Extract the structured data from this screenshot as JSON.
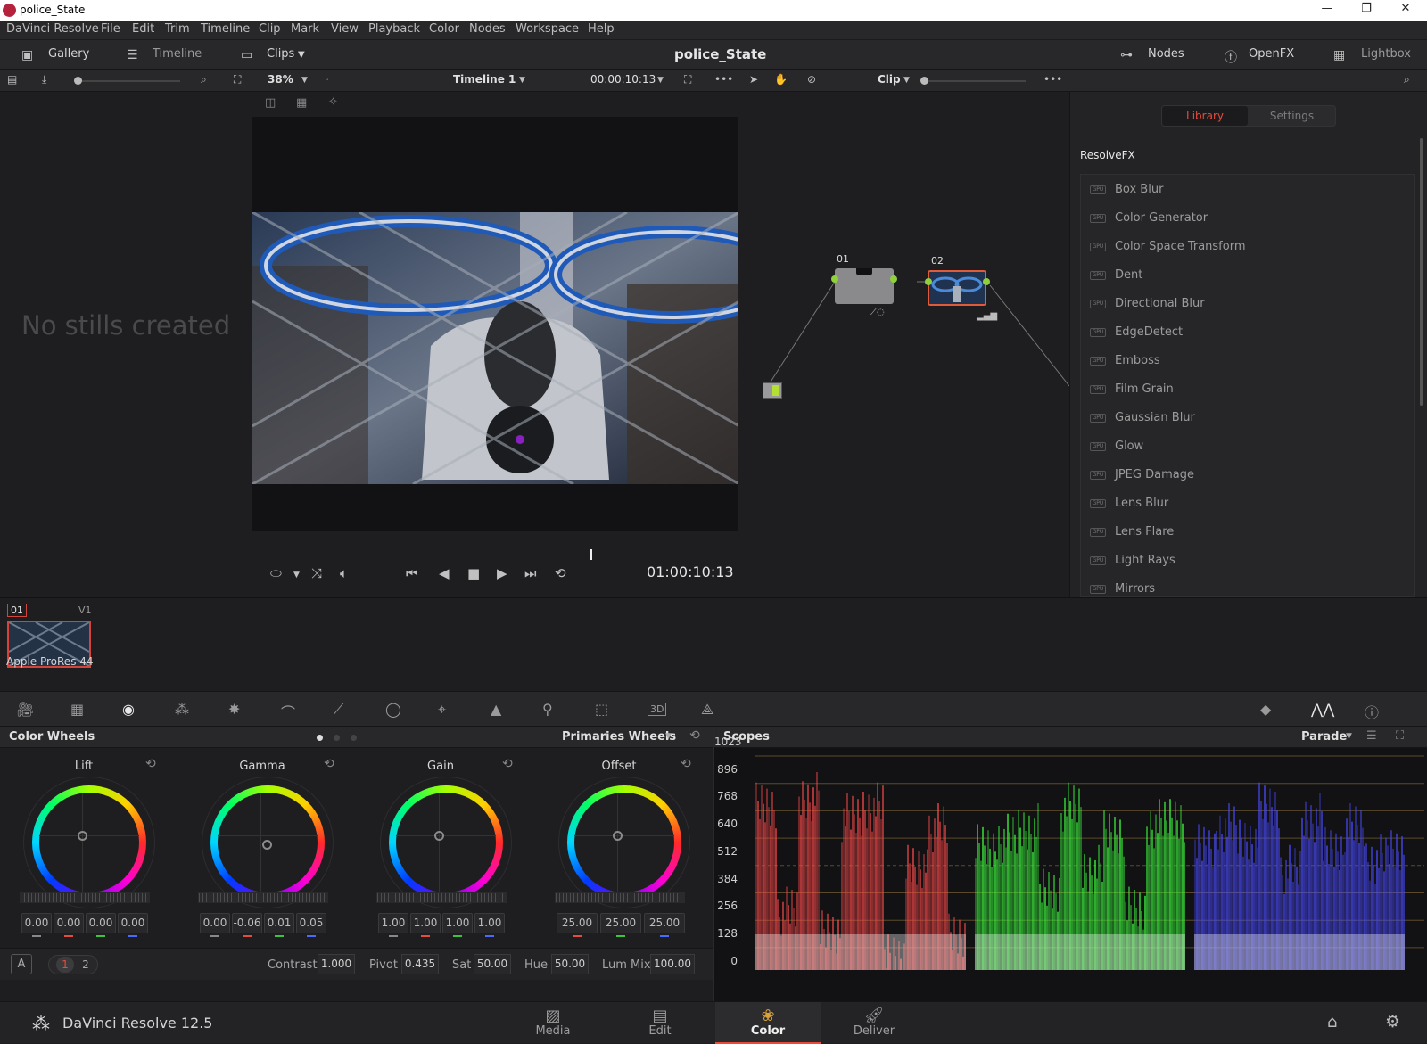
{
  "window": {
    "title": "police_State",
    "min": "—",
    "max": "❐",
    "close": "✕"
  },
  "menu": [
    "DaVinci Resolve",
    "File",
    "Edit",
    "Trim",
    "Timeline",
    "Clip",
    "Mark",
    "View",
    "Playback",
    "Color",
    "Nodes",
    "Workspace",
    "Help"
  ],
  "toolbar": {
    "gallery": "Gallery",
    "timeline": "Timeline",
    "clips": "Clips",
    "project_title": "police_State",
    "nodes": "Nodes",
    "openfx": "OpenFX",
    "lightbox": "Lightbox"
  },
  "viewer": {
    "zoom": "38%",
    "timeline_name": "Timeline 1",
    "timecode": "00:00:10:13",
    "transport_timecode": "01:00:10:13",
    "clip_label": "Clip"
  },
  "gallery": {
    "empty_text": "No stills created"
  },
  "nodes": [
    {
      "id": "01"
    },
    {
      "id": "02"
    }
  ],
  "library": {
    "tab_library": "Library",
    "tab_settings": "Settings",
    "section": "ResolveFX",
    "gpu_badge": "GPU",
    "effects": [
      "Box Blur",
      "Color Generator",
      "Color Space Transform",
      "Dent",
      "Directional Blur",
      "EdgeDetect",
      "Emboss",
      "Film Grain",
      "Gaussian Blur",
      "Glow",
      "JPEG Damage",
      "Lens Blur",
      "Lens Flare",
      "Light Rays",
      "Mirrors"
    ]
  },
  "clip": {
    "number": "01",
    "track": "V1",
    "codec": "Apple ProRes 44"
  },
  "colorwheels": {
    "panel_title": "Color Wheels",
    "mode": "Primaries Wheels",
    "wheels": [
      {
        "label": "Lift",
        "values": [
          "0.00",
          "0.00",
          "0.00",
          "0.00"
        ]
      },
      {
        "label": "Gamma",
        "values": [
          "0.00",
          "-0.06",
          "0.01",
          "0.05"
        ]
      },
      {
        "label": "Gain",
        "values": [
          "1.00",
          "1.00",
          "1.00",
          "1.00"
        ]
      },
      {
        "label": "Offset",
        "values": [
          "25.00",
          "25.00",
          "25.00"
        ]
      }
    ],
    "footer": {
      "a_button": "A",
      "page1": "1",
      "page2": "2",
      "contrast_label": "Contrast",
      "contrast": "1.000",
      "pivot_label": "Pivot",
      "pivot": "0.435",
      "sat_label": "Sat",
      "sat": "50.00",
      "hue_label": "Hue",
      "hue": "50.00",
      "lummix_label": "Lum Mix",
      "lummix": "100.00"
    }
  },
  "scopes": {
    "panel_title": "Scopes",
    "mode": "Parade",
    "axis": [
      "1023",
      "896",
      "768",
      "640",
      "512",
      "384",
      "256",
      "128",
      "0"
    ]
  },
  "bottom": {
    "app": "DaVinci Resolve 12.5",
    "pages": [
      "Media",
      "Edit",
      "Color",
      "Deliver"
    ],
    "active_page": "Color"
  },
  "colors": {
    "accent": "#e84b3a",
    "red": "#ff4a4a",
    "green": "#3cff3c",
    "blue": "#4a4aff",
    "panel": "#1e1e21"
  }
}
